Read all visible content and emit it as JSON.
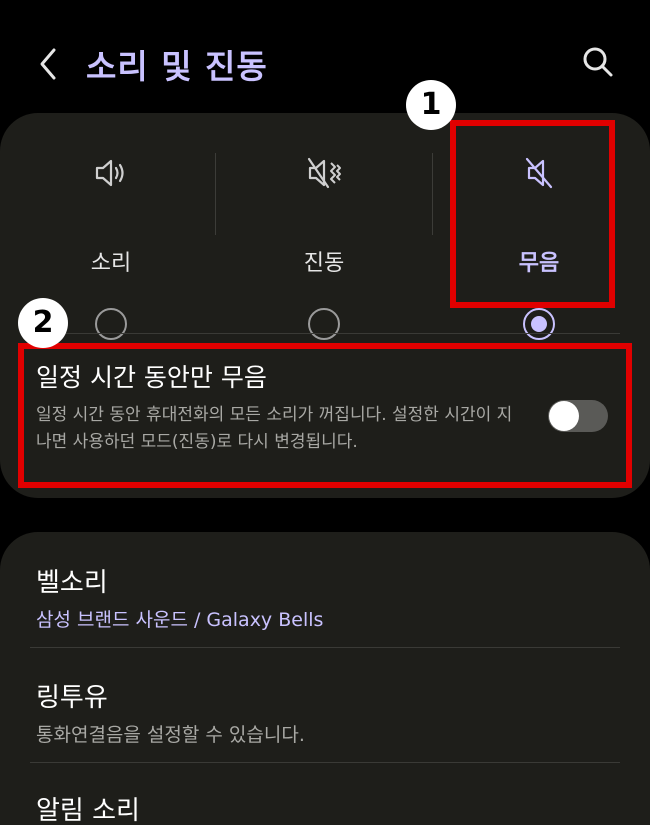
{
  "header": {
    "title": "소리 및 진동",
    "back_icon": "back-arrow-icon",
    "search_icon": "search-icon"
  },
  "modes": [
    {
      "label": "소리",
      "icon": "speaker-icon",
      "selected": false
    },
    {
      "label": "진동",
      "icon": "vibrate-icon",
      "selected": false
    },
    {
      "label": "무음",
      "icon": "mute-icon",
      "selected": true
    }
  ],
  "annotations": {
    "badge1": "1",
    "badge2": "2"
  },
  "timed_mute": {
    "title": "일정 시간 동안만 무음",
    "description": "일정 시간 동안 휴대전화의 모든 소리가 꺼집니다. 설정한 시간이 지나면 사용하던 모드(진동)로 다시 변경됩니다.",
    "enabled": false
  },
  "settings": [
    {
      "title": "벨소리",
      "subtitle": "삼성 브랜드 사운드 / Galaxy Bells"
    },
    {
      "title": "링투유",
      "subtitle": "통화연결음을 설정할 수 있습니다."
    },
    {
      "title": "알림 소리",
      "subtitle": ""
    }
  ],
  "colors": {
    "accent": "#c9c2ff",
    "highlight": "#e00000",
    "card": "#1e1e1a"
  }
}
